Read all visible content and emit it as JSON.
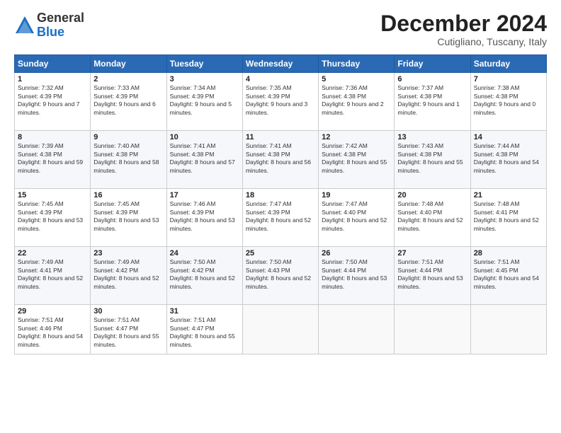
{
  "logo": {
    "general": "General",
    "blue": "Blue"
  },
  "title": "December 2024",
  "subtitle": "Cutigliano, Tuscany, Italy",
  "days_of_week": [
    "Sunday",
    "Monday",
    "Tuesday",
    "Wednesday",
    "Thursday",
    "Friday",
    "Saturday"
  ],
  "weeks": [
    [
      {
        "day": "1",
        "sunrise": "7:32 AM",
        "sunset": "4:39 PM",
        "daylight": "9 hours and 7 minutes."
      },
      {
        "day": "2",
        "sunrise": "7:33 AM",
        "sunset": "4:39 PM",
        "daylight": "9 hours and 6 minutes."
      },
      {
        "day": "3",
        "sunrise": "7:34 AM",
        "sunset": "4:39 PM",
        "daylight": "9 hours and 5 minutes."
      },
      {
        "day": "4",
        "sunrise": "7:35 AM",
        "sunset": "4:39 PM",
        "daylight": "9 hours and 3 minutes."
      },
      {
        "day": "5",
        "sunrise": "7:36 AM",
        "sunset": "4:38 PM",
        "daylight": "9 hours and 2 minutes."
      },
      {
        "day": "6",
        "sunrise": "7:37 AM",
        "sunset": "4:38 PM",
        "daylight": "9 hours and 1 minute."
      },
      {
        "day": "7",
        "sunrise": "7:38 AM",
        "sunset": "4:38 PM",
        "daylight": "9 hours and 0 minutes."
      }
    ],
    [
      {
        "day": "8",
        "sunrise": "7:39 AM",
        "sunset": "4:38 PM",
        "daylight": "8 hours and 59 minutes."
      },
      {
        "day": "9",
        "sunrise": "7:40 AM",
        "sunset": "4:38 PM",
        "daylight": "8 hours and 58 minutes."
      },
      {
        "day": "10",
        "sunrise": "7:41 AM",
        "sunset": "4:38 PM",
        "daylight": "8 hours and 57 minutes."
      },
      {
        "day": "11",
        "sunrise": "7:41 AM",
        "sunset": "4:38 PM",
        "daylight": "8 hours and 56 minutes."
      },
      {
        "day": "12",
        "sunrise": "7:42 AM",
        "sunset": "4:38 PM",
        "daylight": "8 hours and 55 minutes."
      },
      {
        "day": "13",
        "sunrise": "7:43 AM",
        "sunset": "4:38 PM",
        "daylight": "8 hours and 55 minutes."
      },
      {
        "day": "14",
        "sunrise": "7:44 AM",
        "sunset": "4:38 PM",
        "daylight": "8 hours and 54 minutes."
      }
    ],
    [
      {
        "day": "15",
        "sunrise": "7:45 AM",
        "sunset": "4:39 PM",
        "daylight": "8 hours and 53 minutes."
      },
      {
        "day": "16",
        "sunrise": "7:45 AM",
        "sunset": "4:39 PM",
        "daylight": "8 hours and 53 minutes."
      },
      {
        "day": "17",
        "sunrise": "7:46 AM",
        "sunset": "4:39 PM",
        "daylight": "8 hours and 53 minutes."
      },
      {
        "day": "18",
        "sunrise": "7:47 AM",
        "sunset": "4:39 PM",
        "daylight": "8 hours and 52 minutes."
      },
      {
        "day": "19",
        "sunrise": "7:47 AM",
        "sunset": "4:40 PM",
        "daylight": "8 hours and 52 minutes."
      },
      {
        "day": "20",
        "sunrise": "7:48 AM",
        "sunset": "4:40 PM",
        "daylight": "8 hours and 52 minutes."
      },
      {
        "day": "21",
        "sunrise": "7:48 AM",
        "sunset": "4:41 PM",
        "daylight": "8 hours and 52 minutes."
      }
    ],
    [
      {
        "day": "22",
        "sunrise": "7:49 AM",
        "sunset": "4:41 PM",
        "daylight": "8 hours and 52 minutes."
      },
      {
        "day": "23",
        "sunrise": "7:49 AM",
        "sunset": "4:42 PM",
        "daylight": "8 hours and 52 minutes."
      },
      {
        "day": "24",
        "sunrise": "7:50 AM",
        "sunset": "4:42 PM",
        "daylight": "8 hours and 52 minutes."
      },
      {
        "day": "25",
        "sunrise": "7:50 AM",
        "sunset": "4:43 PM",
        "daylight": "8 hours and 52 minutes."
      },
      {
        "day": "26",
        "sunrise": "7:50 AM",
        "sunset": "4:44 PM",
        "daylight": "8 hours and 53 minutes."
      },
      {
        "day": "27",
        "sunrise": "7:51 AM",
        "sunset": "4:44 PM",
        "daylight": "8 hours and 53 minutes."
      },
      {
        "day": "28",
        "sunrise": "7:51 AM",
        "sunset": "4:45 PM",
        "daylight": "8 hours and 54 minutes."
      }
    ],
    [
      {
        "day": "29",
        "sunrise": "7:51 AM",
        "sunset": "4:46 PM",
        "daylight": "8 hours and 54 minutes."
      },
      {
        "day": "30",
        "sunrise": "7:51 AM",
        "sunset": "4:47 PM",
        "daylight": "8 hours and 55 minutes."
      },
      {
        "day": "31",
        "sunrise": "7:51 AM",
        "sunset": "4:47 PM",
        "daylight": "8 hours and 55 minutes."
      },
      null,
      null,
      null,
      null
    ]
  ]
}
